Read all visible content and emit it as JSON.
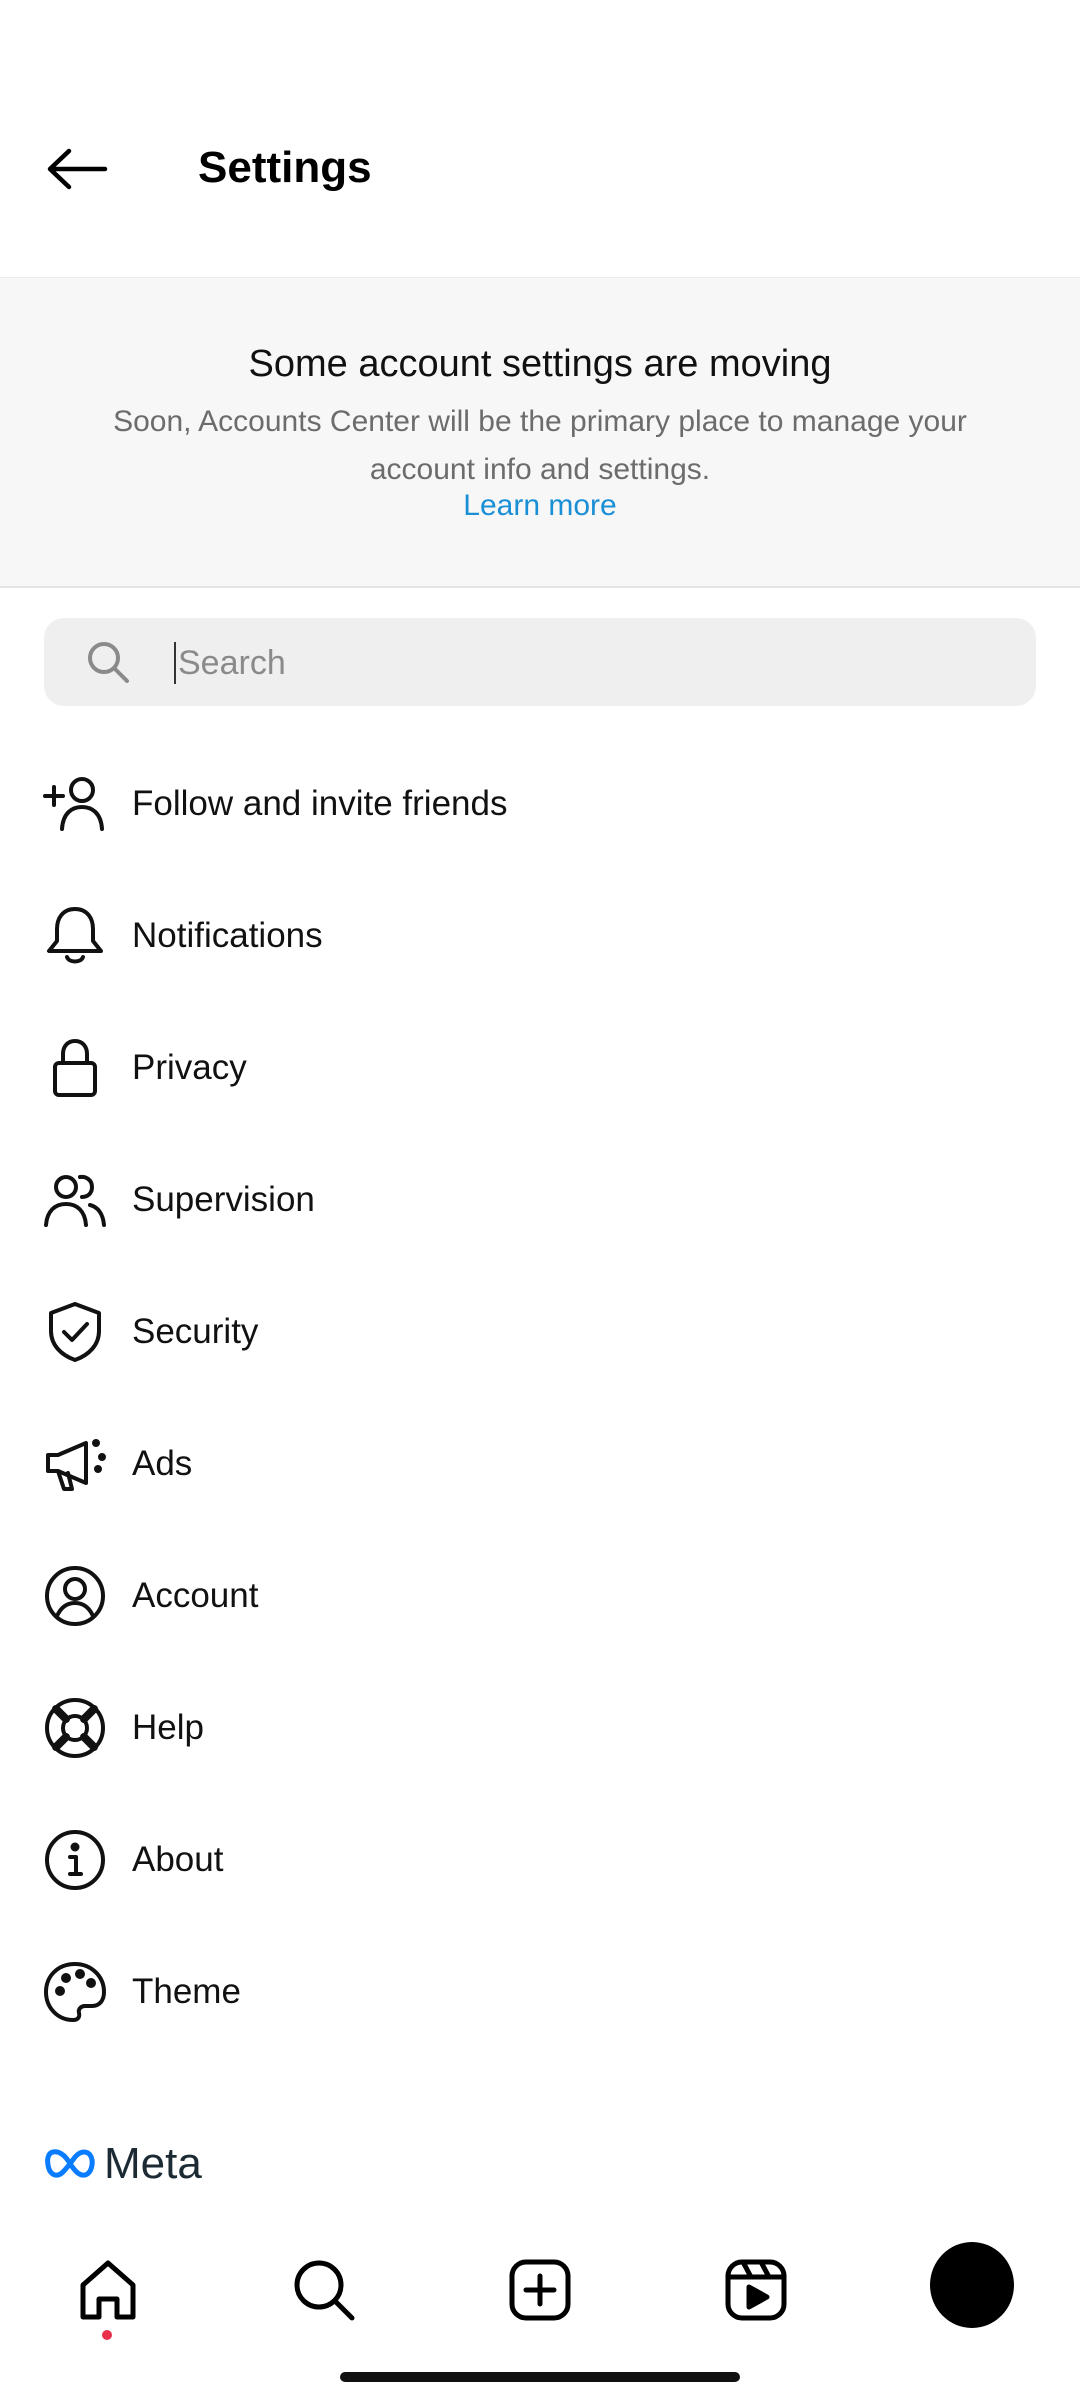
{
  "header": {
    "title": "Settings"
  },
  "banner": {
    "title": "Some account settings are moving",
    "body": "Soon, Accounts Center will be the primary place to manage your account info and settings.",
    "link": "Learn more"
  },
  "search": {
    "placeholder": "Search",
    "value": ""
  },
  "menu": [
    {
      "label": "Follow and invite friends",
      "icon": "add-person-icon"
    },
    {
      "label": "Notifications",
      "icon": "bell-icon"
    },
    {
      "label": "Privacy",
      "icon": "lock-icon"
    },
    {
      "label": "Supervision",
      "icon": "people-icon"
    },
    {
      "label": "Security",
      "icon": "shield-check-icon"
    },
    {
      "label": "Ads",
      "icon": "megaphone-icon"
    },
    {
      "label": "Account",
      "icon": "user-circle-icon"
    },
    {
      "label": "Help",
      "icon": "lifebuoy-icon"
    },
    {
      "label": "About",
      "icon": "info-icon"
    },
    {
      "label": "Theme",
      "icon": "palette-icon"
    }
  ],
  "footer": {
    "brand": "Meta"
  },
  "tabbar": {
    "tabs": [
      "home-icon",
      "search-icon",
      "create-icon",
      "reels-icon",
      "profile-avatar"
    ],
    "notification_dot_color": "#e8304a"
  },
  "colors": {
    "link": "#1a8fd6",
    "banner_bg": "#f7f7f7",
    "search_bg": "#efefef"
  }
}
